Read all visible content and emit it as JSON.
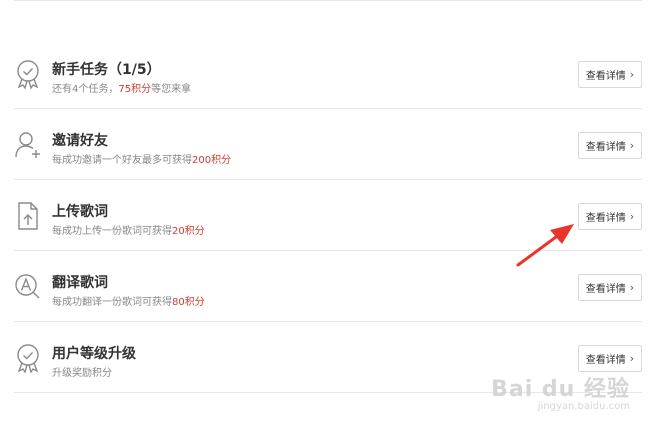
{
  "tasks": [
    {
      "icon": "badge-icon",
      "title": "新手任务（1/5）",
      "desc_pre": "还有4个任务，",
      "desc_hl": "75积分",
      "desc_post": "等您来拿",
      "button_label": "查看详情"
    },
    {
      "icon": "add-user-icon",
      "title": "邀请好友",
      "desc_pre": "每成功邀请一个好友最多可获得",
      "desc_hl": "200积分",
      "desc_post": "",
      "button_label": "查看详情"
    },
    {
      "icon": "upload-file-icon",
      "title": "上传歌词",
      "desc_pre": "每成功上传一份歌词可获得",
      "desc_hl": "20积分",
      "desc_post": "",
      "button_label": "查看详情"
    },
    {
      "icon": "translate-icon",
      "title": "翻译歌词",
      "desc_pre": "每成功翻译一份歌词可获得",
      "desc_hl": "80积分",
      "desc_post": "",
      "button_label": "查看详情"
    },
    {
      "icon": "badge-icon",
      "title": "用户等级升级",
      "desc_pre": "升级奖励积分",
      "desc_hl": "",
      "desc_post": "",
      "button_label": "查看详情"
    }
  ],
  "chevron": "›",
  "watermark": {
    "logo": "Bai du 经验",
    "url": "jingyan.baidu.com"
  },
  "colors": {
    "highlight": "#d33a31",
    "arrow": "#e8342b",
    "divider": "#e8e8e8"
  }
}
